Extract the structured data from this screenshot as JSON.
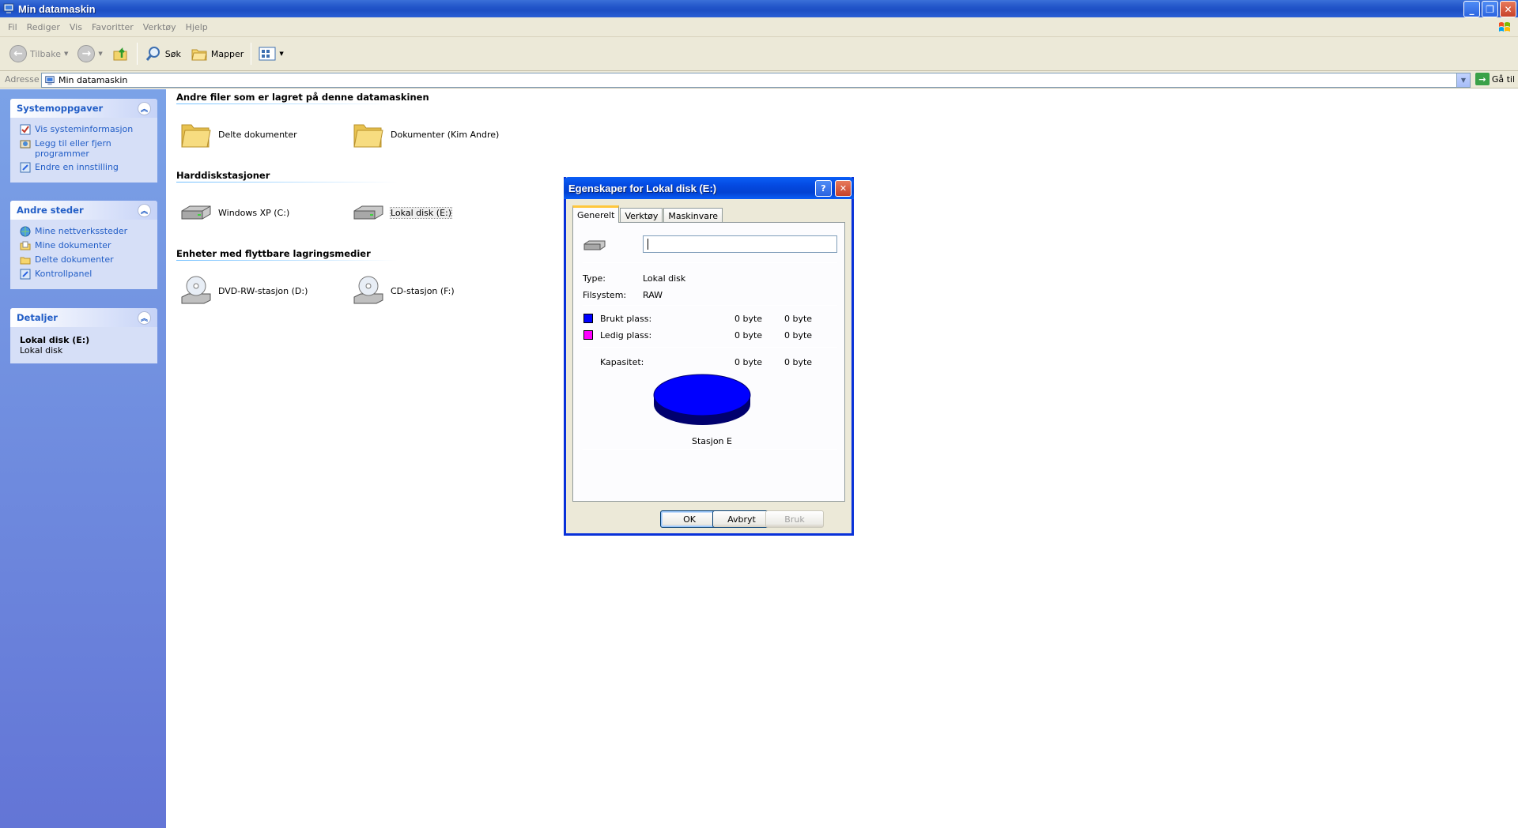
{
  "window": {
    "title": "Min datamaskin"
  },
  "menu": [
    "Fil",
    "Rediger",
    "Vis",
    "Favoritter",
    "Verktøy",
    "Hjelp"
  ],
  "toolbar": {
    "back": "Tilbake",
    "search": "Søk",
    "folders": "Mapper"
  },
  "address": {
    "label": "Adresse",
    "value": "Min datamaskin",
    "go": "Gå til"
  },
  "sidebar": {
    "system": {
      "title": "Systemoppgaver",
      "items": [
        "Vis systeminformasjon",
        "Legg til eller fjern programmer",
        "Endre en innstilling"
      ]
    },
    "places": {
      "title": "Andre steder",
      "items": [
        "Mine nettverkssteder",
        "Mine dokumenter",
        "Delte dokumenter",
        "Kontrollpanel"
      ]
    },
    "details": {
      "title": "Detaljer",
      "name": "Lokal disk (E:)",
      "type": "Lokal disk"
    }
  },
  "groups": {
    "files": {
      "title": "Andre filer som er lagret på denne datamaskinen",
      "items": [
        "Delte dokumenter",
        "Dokumenter (Kim Andre)"
      ]
    },
    "hdd": {
      "title": "Harddiskstasjoner",
      "items": [
        "Windows XP (C:)",
        "Lokal disk (E:)"
      ]
    },
    "removable": {
      "title": "Enheter med flyttbare lagringsmedier",
      "items": [
        "DVD-RW-stasjon (D:)",
        "CD-stasjon (F:)"
      ]
    }
  },
  "dialog": {
    "title": "Egenskaper for Lokal disk (E:)",
    "help": "?",
    "tabs": [
      "Generelt",
      "Verktøy",
      "Maskinvare"
    ],
    "name_value": "",
    "type_label": "Type:",
    "type_value": "Lokal disk",
    "fs_label": "Filsystem:",
    "fs_value": "RAW",
    "used_label": "Brukt plass:",
    "used_bytes": "0 byte",
    "used_size": "0 byte",
    "free_label": "Ledig plass:",
    "free_bytes": "0 byte",
    "free_size": "0 byte",
    "cap_label": "Kapasitet:",
    "cap_bytes": "0 byte",
    "cap_size": "0 byte",
    "drive_label": "Stasjon E",
    "ok": "OK",
    "cancel": "Avbryt",
    "apply": "Bruk",
    "colors": {
      "used": "#0000ff",
      "free": "#ff00ff"
    }
  }
}
